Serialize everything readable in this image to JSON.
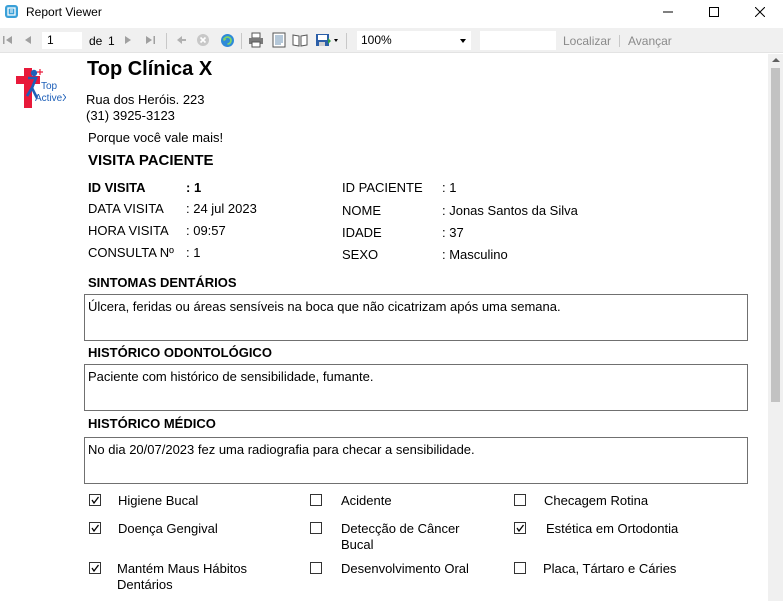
{
  "window": {
    "title": "Report Viewer"
  },
  "toolbar": {
    "page_current": "1",
    "page_of_label": "de",
    "page_total": "1",
    "zoom": "100%",
    "find_label": "Localizar",
    "next_label": "Avançar"
  },
  "report": {
    "clinic_name": "Top Clínica X",
    "logo_text_1": "Top",
    "logo_text_2": "ActiveX",
    "address_line_1": "Rua dos Heróis. 223",
    "address_line_2": "(31) 3925-3123",
    "slogan": "Porque você vale mais!",
    "section_title": "VISITA PACIENTE",
    "visit": [
      {
        "label": "ID VISITA",
        "value": ": 1"
      },
      {
        "label": "DATA VISITA",
        "value": ": 24 jul 2023"
      },
      {
        "label": "HORA VISITA",
        "value": ": 09:57"
      },
      {
        "label": "CONSULTA Nº",
        "value": ": 1"
      }
    ],
    "patient": [
      {
        "label": "ID PACIENTE",
        "value": ": 1"
      },
      {
        "label": "NOME",
        "value": ": Jonas Santos da Silva"
      },
      {
        "label": "IDADE",
        "value": ": 37"
      },
      {
        "label": "SEXO",
        "value": ": Masculino"
      }
    ],
    "blocks": [
      {
        "title": "SINTOMAS DENTÁRIOS",
        "text": "Úlcera, feridas ou áreas sensíveis na boca que não cicatrizam após uma semana."
      },
      {
        "title": "HISTÓRICO ODONTOLÓGICO",
        "text": "Paciente com histórico de sensibilidade, fumante."
      },
      {
        "title": "HISTÓRICO MÉDICO",
        "text": "No dia 20/07/2023 fez uma radiografia para checar a sensibilidade."
      }
    ],
    "checkboxes": [
      {
        "label": "Higiene Bucal",
        "checked": true
      },
      {
        "label": "Acidente",
        "checked": false
      },
      {
        "label": "Checagem Rotina",
        "checked": false
      },
      {
        "label": "Doença Gengival",
        "checked": true
      },
      {
        "label": "Detecção de Câncer Bucal",
        "checked": false
      },
      {
        "label": "Estética em Ortodontia",
        "checked": true
      },
      {
        "label": "Mantém Maus Hábitos Dentários",
        "checked": true
      },
      {
        "label": "Desenvolvimento Oral",
        "checked": false
      },
      {
        "label": "Placa, Tártaro e Cáries",
        "checked": false
      }
    ]
  },
  "colors": {
    "logo_red": "#e8193a",
    "logo_blue": "#1d5fb8",
    "toolbar_bg": "#f0f0f0",
    "link_grey": "#8a8a8a"
  },
  "icons": [
    "app-icon",
    "minimize-icon",
    "maximize-icon",
    "close-icon",
    "first-page-icon",
    "prev-page-icon",
    "next-page-icon",
    "last-page-icon",
    "back-icon",
    "stop-icon",
    "refresh-icon",
    "print-icon",
    "print-layout-icon",
    "page-setup-icon",
    "export-icon",
    "dropdown-arrow-icon",
    "checkmark-icon"
  ]
}
